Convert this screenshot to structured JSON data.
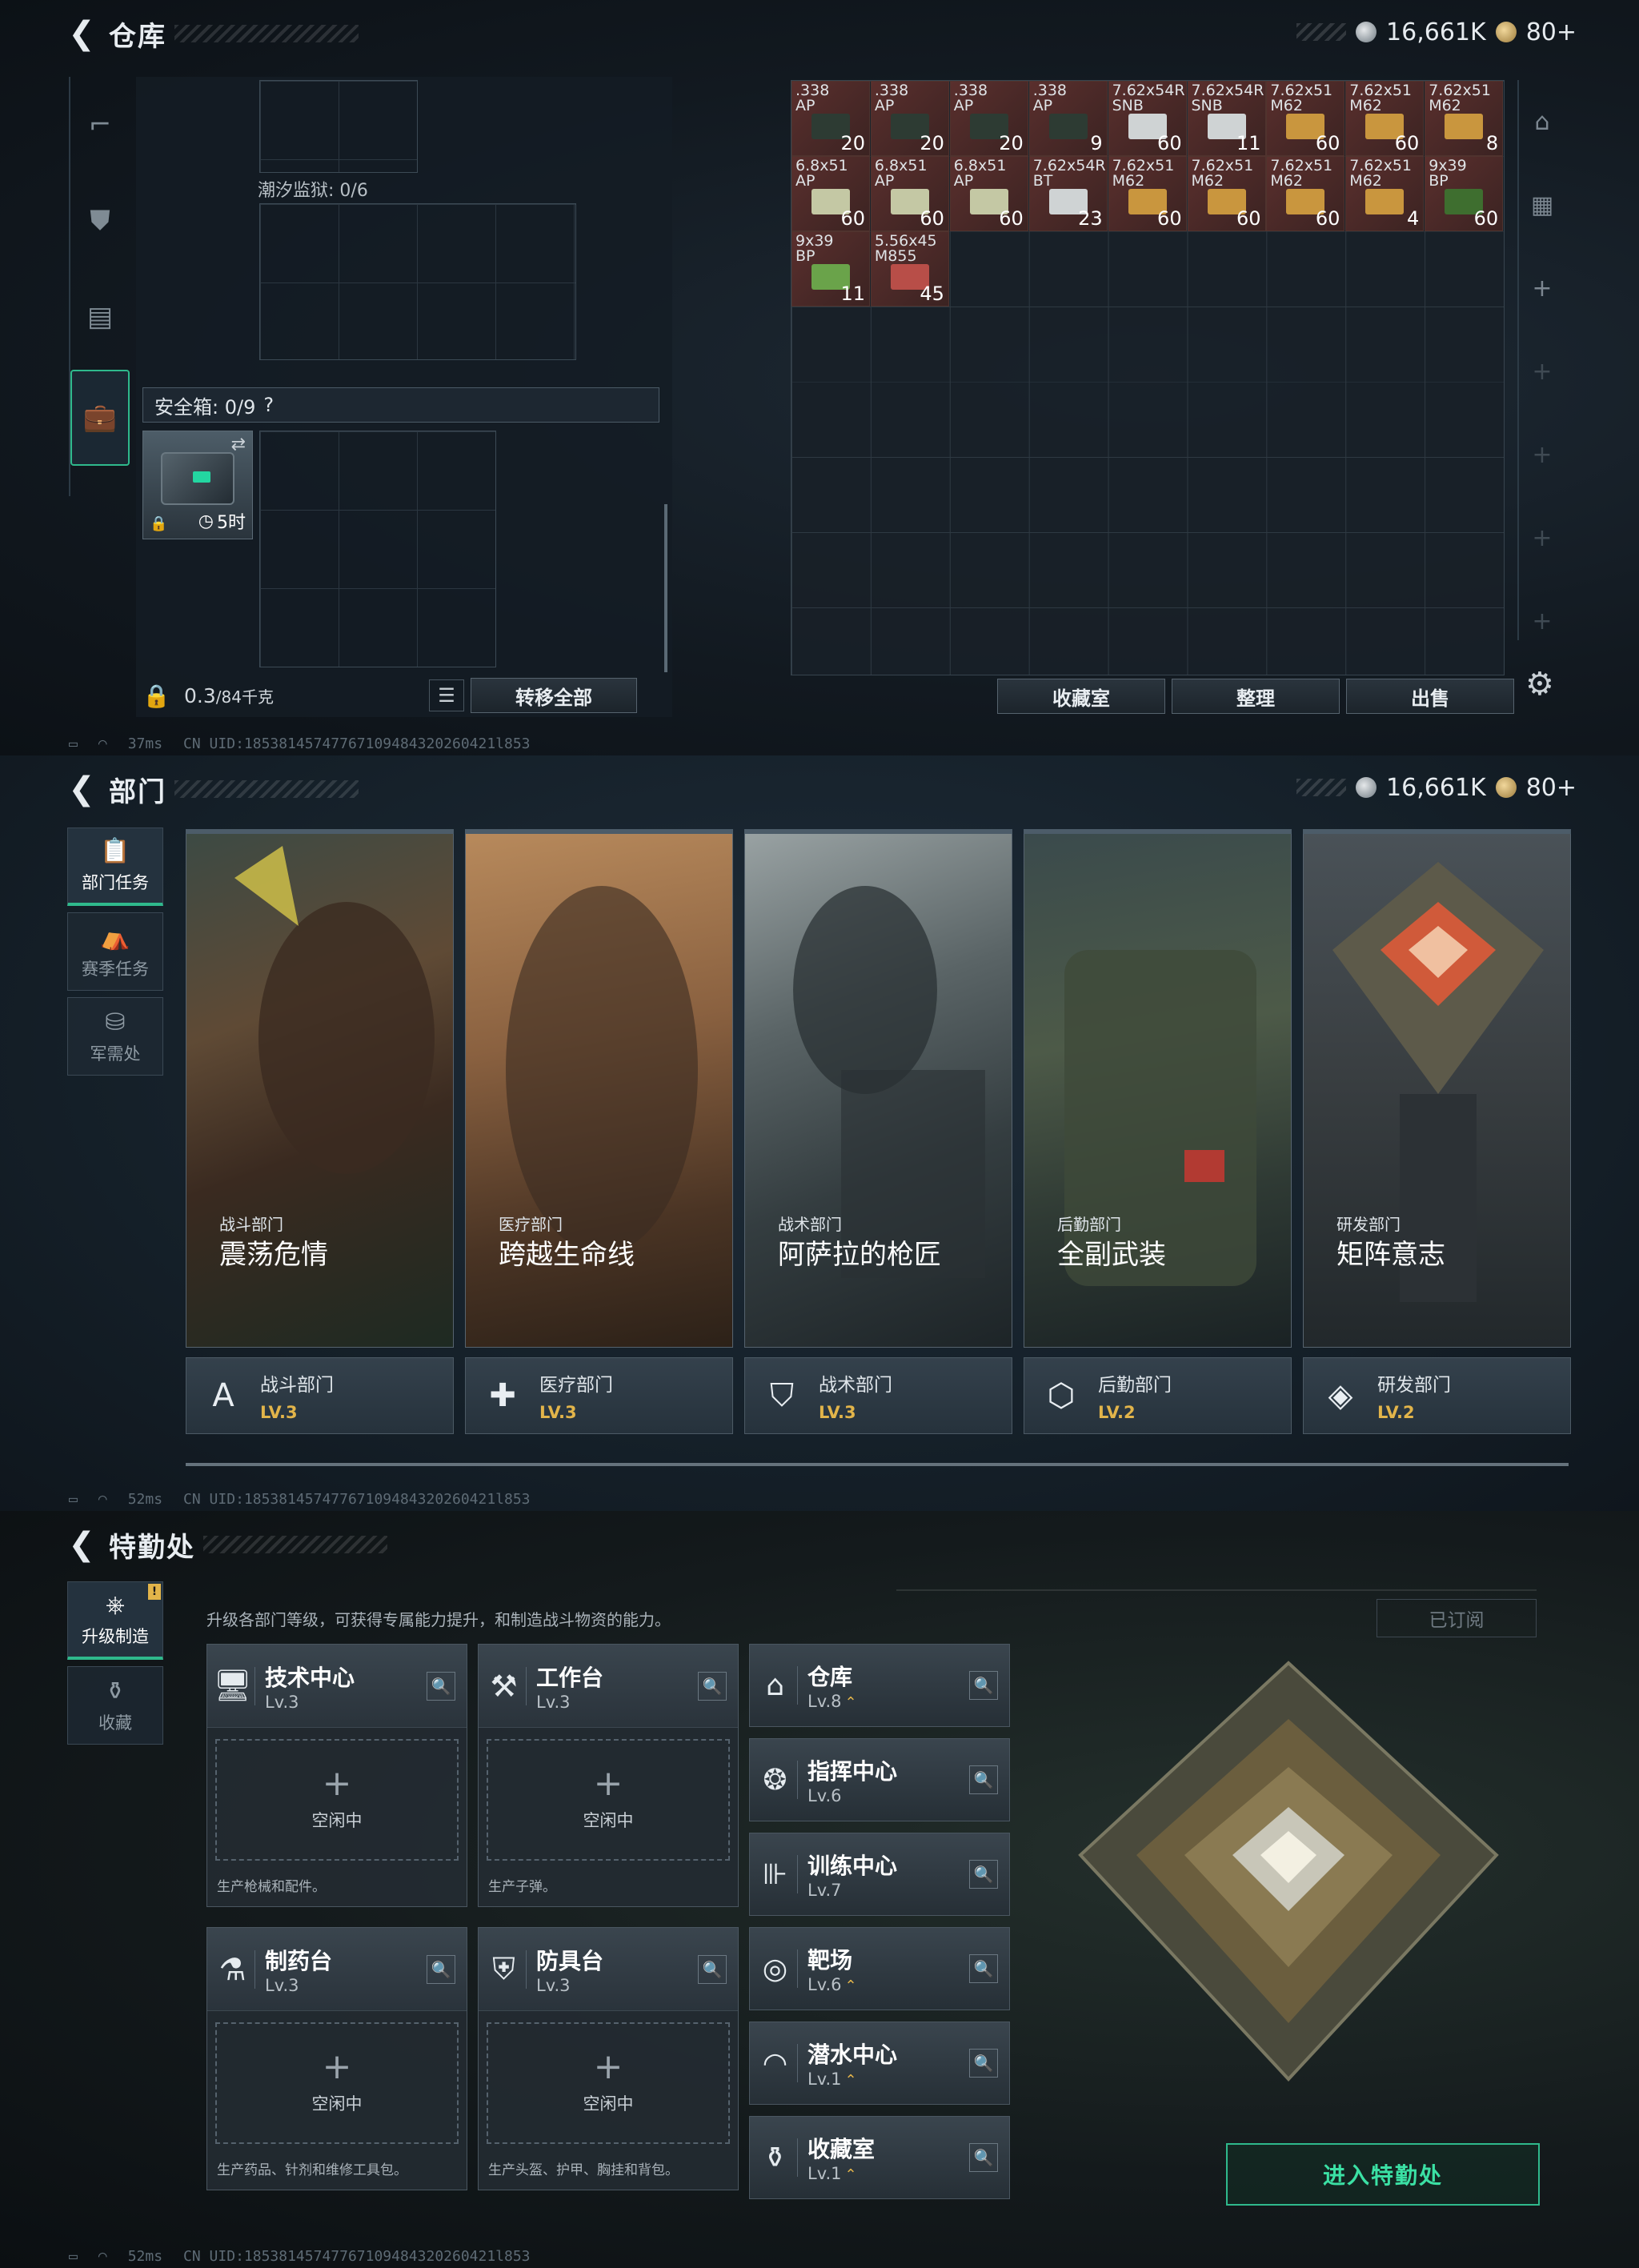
{
  "status": {
    "ping1": "37ms",
    "ping2": "52ms",
    "ping3": "52ms",
    "uid": "CN UID:18538145747767109484320260421l853"
  },
  "currency": {
    "silver": "16,661K",
    "gold": "80+"
  },
  "warehouse": {
    "title": "仓库",
    "sidebar_icons": [
      "pistol-icon",
      "armor-icon",
      "backpack-icon",
      "briefcase-icon"
    ],
    "tidal_label": "潮汐监狱: 0/6",
    "safe_label": "安全箱: 0/9",
    "safe_help": "?",
    "safe_timer": "5时",
    "weight": "0.3",
    "weight_cap": "/84千克",
    "transfer_all": "转移全部",
    "stash_buttons": [
      "收藏室",
      "整理",
      "出售"
    ],
    "ammo_row1": [
      {
        "name": ".338\nAP",
        "count": "20",
        "color": "#2d3b33"
      },
      {
        "name": ".338\nAP",
        "count": "20",
        "color": "#2d3b33"
      },
      {
        "name": ".338\nAP",
        "count": "20",
        "color": "#2d3b33"
      },
      {
        "name": ".338\nAP",
        "count": "9",
        "color": "#2d3b33"
      },
      {
        "name": "7.62x54R\nSNB",
        "count": "60",
        "color": "#cfd3d4"
      },
      {
        "name": "7.62x54R\nSNB",
        "count": "11",
        "color": "#cfd3d4"
      },
      {
        "name": "7.62x51\nM62",
        "count": "60",
        "color": "#c9963e"
      },
      {
        "name": "7.62x51\nM62",
        "count": "60",
        "color": "#c9963e"
      },
      {
        "name": "7.62x51\nM62",
        "count": "8",
        "color": "#c9963e"
      }
    ],
    "ammo_row2": [
      {
        "name": "6.8x51\nAP",
        "count": "60",
        "color": "#c4c8a4"
      },
      {
        "name": "6.8x51\nAP",
        "count": "60",
        "color": "#c4c8a4"
      },
      {
        "name": "6.8x51\nAP",
        "count": "60",
        "color": "#c4c8a4"
      },
      {
        "name": "7.62x54R\nBT",
        "count": "23",
        "color": "#cfd3d4"
      },
      {
        "name": "7.62x51\nM62",
        "count": "60",
        "color": "#c9963e"
      },
      {
        "name": "7.62x51\nM62",
        "count": "60",
        "color": "#c9963e"
      },
      {
        "name": "7.62x51\nM62",
        "count": "60",
        "color": "#c9963e"
      },
      {
        "name": "7.62x51\nM62",
        "count": "4",
        "color": "#c9963e"
      },
      {
        "name": "9x39\nBP",
        "count": "60",
        "color": "#3e6e2f"
      }
    ],
    "ammo_row3": [
      {
        "name": "9x39\nBP",
        "count": "11",
        "color": "#6aa34a"
      },
      {
        "name": "5.56x45\nM855",
        "count": "45",
        "color": "#b84e48"
      }
    ]
  },
  "departments": {
    "title": "部门",
    "nav": [
      {
        "label": "部门任务",
        "icon": "mission-icon"
      },
      {
        "label": "赛季任务",
        "icon": "season-icon"
      },
      {
        "label": "军需处",
        "icon": "supply-icon"
      }
    ],
    "cards": [
      {
        "sub": "战斗部门",
        "name": "震荡危情",
        "dept": "战斗部门",
        "level": "LV.3",
        "icon": "A"
      },
      {
        "sub": "医疗部门",
        "name": "跨越生命线",
        "dept": "医疗部门",
        "level": "LV.3",
        "icon": "✚"
      },
      {
        "sub": "战术部门",
        "name": "阿萨拉的枪匠",
        "dept": "战术部门",
        "level": "LV.3",
        "icon": "⛉"
      },
      {
        "sub": "后勤部门",
        "name": "全副武装",
        "dept": "后勤部门",
        "level": "LV.2",
        "icon": "⬡"
      },
      {
        "sub": "研发部门",
        "name": "矩阵意志",
        "dept": "研发部门",
        "level": "LV.2",
        "icon": "◈"
      }
    ]
  },
  "special": {
    "title": "特勤处",
    "nav": [
      {
        "label": "升级制造",
        "icon": "upgrade-icon"
      },
      {
        "label": "收藏",
        "icon": "collection-icon"
      }
    ],
    "badge": "!",
    "description": "升级各部门等级，可获得专属能力提升，和制造战斗物资的能力。",
    "subscribed": "已订阅",
    "idle": "空闲中",
    "facilities": [
      {
        "name": "技术中心",
        "level": "Lv.3",
        "desc": "生产枪械和配件。",
        "icon": "🖥"
      },
      {
        "name": "工作台",
        "level": "Lv.3",
        "desc": "生产子弹。",
        "icon": "⚒"
      },
      {
        "name": "制药台",
        "level": "Lv.3",
        "desc": "生产药品、针剂和维修工具包。",
        "icon": "⚗"
      },
      {
        "name": "防具台",
        "level": "Lv.3",
        "desc": "生产头盔、护甲、胸挂和背包。",
        "icon": "⛨"
      }
    ],
    "rooms": [
      {
        "name": "仓库",
        "level": "Lv.8",
        "up": "⌃",
        "icon": "⌂"
      },
      {
        "name": "指挥中心",
        "level": "Lv.6",
        "up": "",
        "icon": "❂"
      },
      {
        "name": "训练中心",
        "level": "Lv.7",
        "up": "",
        "icon": "⊪"
      },
      {
        "name": "靶场",
        "level": "Lv.6",
        "up": "⌃",
        "icon": "◎"
      },
      {
        "name": "潜水中心",
        "level": "Lv.1",
        "up": "⌃",
        "icon": "◠"
      },
      {
        "name": "收藏室",
        "level": "Lv.1",
        "up": "⌃",
        "icon": "⚱"
      }
    ],
    "enter_button": "进入特勤处"
  }
}
